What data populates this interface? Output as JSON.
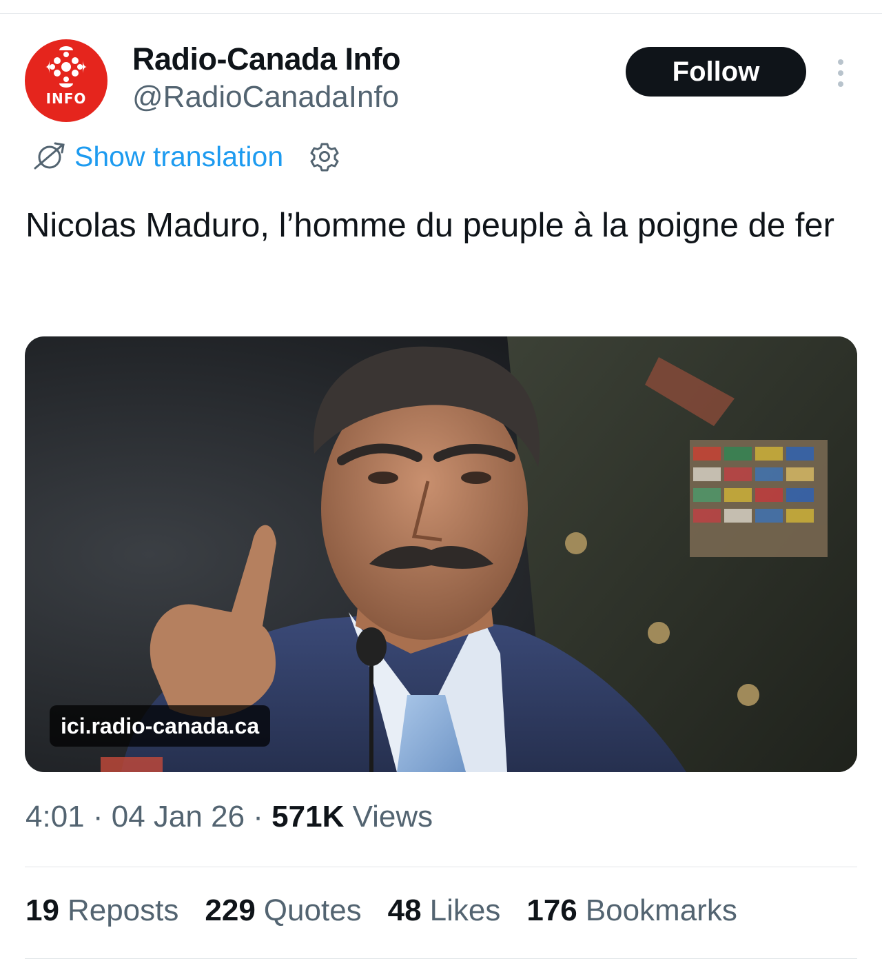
{
  "account": {
    "avatar_text": "INFO",
    "display_name": "Radio-Canada Info",
    "handle": "@RadioCanadaInfo"
  },
  "actions": {
    "follow_label": "Follow",
    "show_translation_label": "Show translation"
  },
  "tweet": {
    "text": "Nicolas Maduro, l’homme du peuple à la poigne de fer",
    "link_domain": "ici.radio-canada.ca"
  },
  "meta": {
    "time": "4:01",
    "date": "04 Jan 26",
    "separator": "·",
    "views_count": "571K",
    "views_label": "Views"
  },
  "stats": [
    {
      "count": "19",
      "label": "Reposts"
    },
    {
      "count": "229",
      "label": "Quotes"
    },
    {
      "count": "48",
      "label": "Likes"
    },
    {
      "count": "176",
      "label": "Bookmarks"
    }
  ],
  "colors": {
    "brand_red": "#e5251d",
    "link_blue": "#1d9bf0",
    "text_primary": "#0f1419",
    "text_secondary": "#536471",
    "follow_bg": "#0f1419"
  },
  "icons": {
    "more": "more-vertical-icon",
    "translate": "translate-icon",
    "settings": "gear-icon",
    "logo": "radio-canada-gem-logo"
  }
}
